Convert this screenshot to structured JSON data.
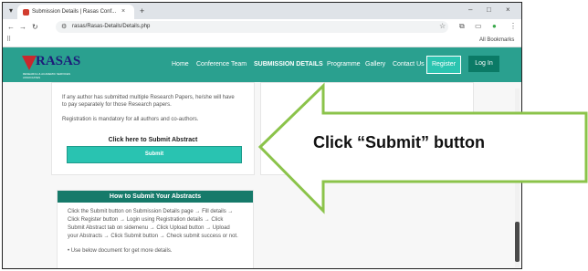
{
  "browser": {
    "tab_title": "Submission Details | Rasas Conf...",
    "tab_close": "×",
    "new_tab": "+",
    "url": "rasas/Rasas-Details/Details.php",
    "window_controls": [
      "–",
      "□",
      "×"
    ],
    "bookmarks_label": "All Bookmarks"
  },
  "site": {
    "logo_text": "RASAS",
    "logo_subtitle": "RESEARCH & ACADEMIC SERVICES ASSOCIATES",
    "nav": [
      {
        "label": "Home"
      },
      {
        "label": "Conference Team"
      },
      {
        "label": "SUBMISSION DETAILS"
      },
      {
        "label": "Programme"
      },
      {
        "label": "Gallery"
      },
      {
        "label": "Contact Us"
      }
    ],
    "register_label": "Register",
    "login_label": "Log In"
  },
  "content": {
    "para1_line1": "If any author has submitted multiple Research Papers, he/she will have",
    "para1_line2": "to pay separately for those Research papers.",
    "para2": "Registration is mandatory for all authors and co-authors.",
    "click_here": "Click here to Submit Abstract",
    "submit_button": "Submit",
    "how_to_title": "How to Submit Your Abstracts",
    "steps": [
      "Click the Submit button on Submission Details page → Fill details →",
      "Click Register button → Login using Registration details → Click",
      "Submit Abstract tab on sidemenu → Click Upload button → Upload",
      "your Abstracts → Click Submit button → Check submit success or not."
    ],
    "note": "• Use below document for get more details."
  },
  "annotation": {
    "text": "Click “Submit” button",
    "arrow_stroke": "#8bc34a",
    "arrow_fill": "#ffffff"
  },
  "colors": {
    "nav_bg": "#2aa08f",
    "submit_bg": "#29c3b1",
    "header_dark": "#167a6a"
  }
}
